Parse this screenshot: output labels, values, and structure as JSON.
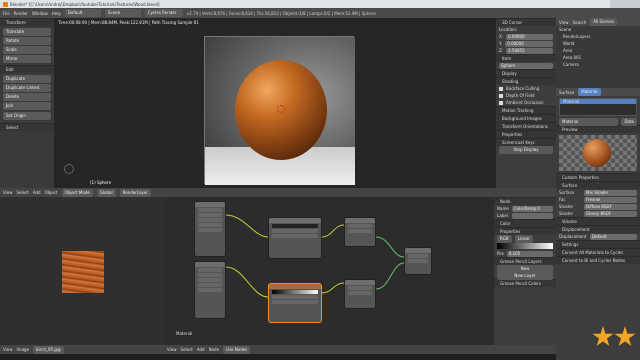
{
  "window": {
    "title": "Blender* [C:\\Users\\Andrej\\Dropbox\\Youtube\\Tutorials\\Textures\\Wood.blend]"
  },
  "menu": [
    "File",
    "Render",
    "Window",
    "Help"
  ],
  "header": {
    "layout": "Default",
    "scene": "Scene",
    "engine": "Cycles Render",
    "stats": "v2.79 | Verts:8,676 | Faces:8,634 | Tris:16,810 | Objects:1/8 | Lamps:0/2 | Mem:52.9M | Sphere"
  },
  "toolshelf": {
    "transform_section": "Transform",
    "transform_items": [
      "Translate",
      "Rotate",
      "Scale",
      "Mirror"
    ],
    "edit_section": "Edit",
    "edit_items": [
      "Duplicate",
      "Duplicate Linked",
      "Delete",
      "Join"
    ],
    "set_origin": "Set Origin",
    "select_section": "Select"
  },
  "viewport": {
    "render_status": "Time:00:08.90 | Mem:88.84M, Peak:122.81M | Path Tracing Sample 61",
    "object_label": "(1) Sphere",
    "header_items": [
      "View",
      "Select",
      "Add",
      "Object"
    ],
    "mode": "Object Mode",
    "pivot": "Global",
    "render_layer": "RenderLayer"
  },
  "n_panel": {
    "sections": [
      "3D Cursor",
      "Item",
      "Display",
      "Shading",
      "Motion Tracking",
      "Background Images",
      "Transform Orientations",
      "Properties",
      "Screencast Keys"
    ],
    "location_label": "Location:",
    "x": "X:",
    "y": "Y:",
    "z": "Z:",
    "x_val": "0.00000",
    "y_val": "0.00000",
    "z_val": "2.50655",
    "item_name": "Sphere",
    "shading_opts": [
      "Backface Culling",
      "Depth Of Field",
      "Ambient Occlusion"
    ],
    "stop_display": "Stop Display"
  },
  "outliner": {
    "header": [
      "View",
      "Search",
      "All Scenes"
    ],
    "items": [
      "Scene",
      "RenderLayers",
      "World",
      "Area",
      "Area.001",
      "Camera"
    ]
  },
  "properties": {
    "tabs": [
      "Surface",
      "Material"
    ],
    "material_name": "Material",
    "data_label": "Data",
    "preview": "Preview",
    "custom_props": "Custom Properties",
    "surface": "Surface",
    "surface_label": "Surface",
    "surface_val": "Mix Shader",
    "fac_label": "Fac",
    "fac_val": "Fresnel",
    "shader1_label": "Shader",
    "shader1_val": "Diffuse BSDF",
    "shader2_label": "Shader",
    "shader2_val": "Glossy BSDF",
    "volume": "Volume",
    "displacement": "Displacement",
    "displacement_label": "Displacement",
    "displacement_val": "Default",
    "settings": "Settings",
    "convert1": "Convert All Materials to Cycles",
    "convert2": "Convert to Bl and Cycles Nodes"
  },
  "node_editor": {
    "label": "Material",
    "header_items": [
      "View",
      "Select",
      "Add",
      "Node"
    ],
    "use_nodes": "Use Nodes",
    "side_panel": {
      "node_section": "Node",
      "name_label": "Name",
      "name_val": "ColorRamp.0",
      "label_label": "Label",
      "color_section": "Color",
      "properties": "Properties",
      "rgb": "RGB",
      "linear": "Linear",
      "pos_label": "Pos",
      "pos_val": "0.105",
      "grease_pencil": "Grease Pencil Layers",
      "new": "New",
      "new_layer": "New Layer",
      "grease_colors": "Grease Pencil Colors"
    }
  },
  "image_editor": {
    "header_items": [
      "View",
      "Image"
    ],
    "image_name": "birch_05.jpg"
  },
  "colors": {
    "accent": "#5680c2",
    "active_node": "#e9912f",
    "star": "#f3a623"
  }
}
